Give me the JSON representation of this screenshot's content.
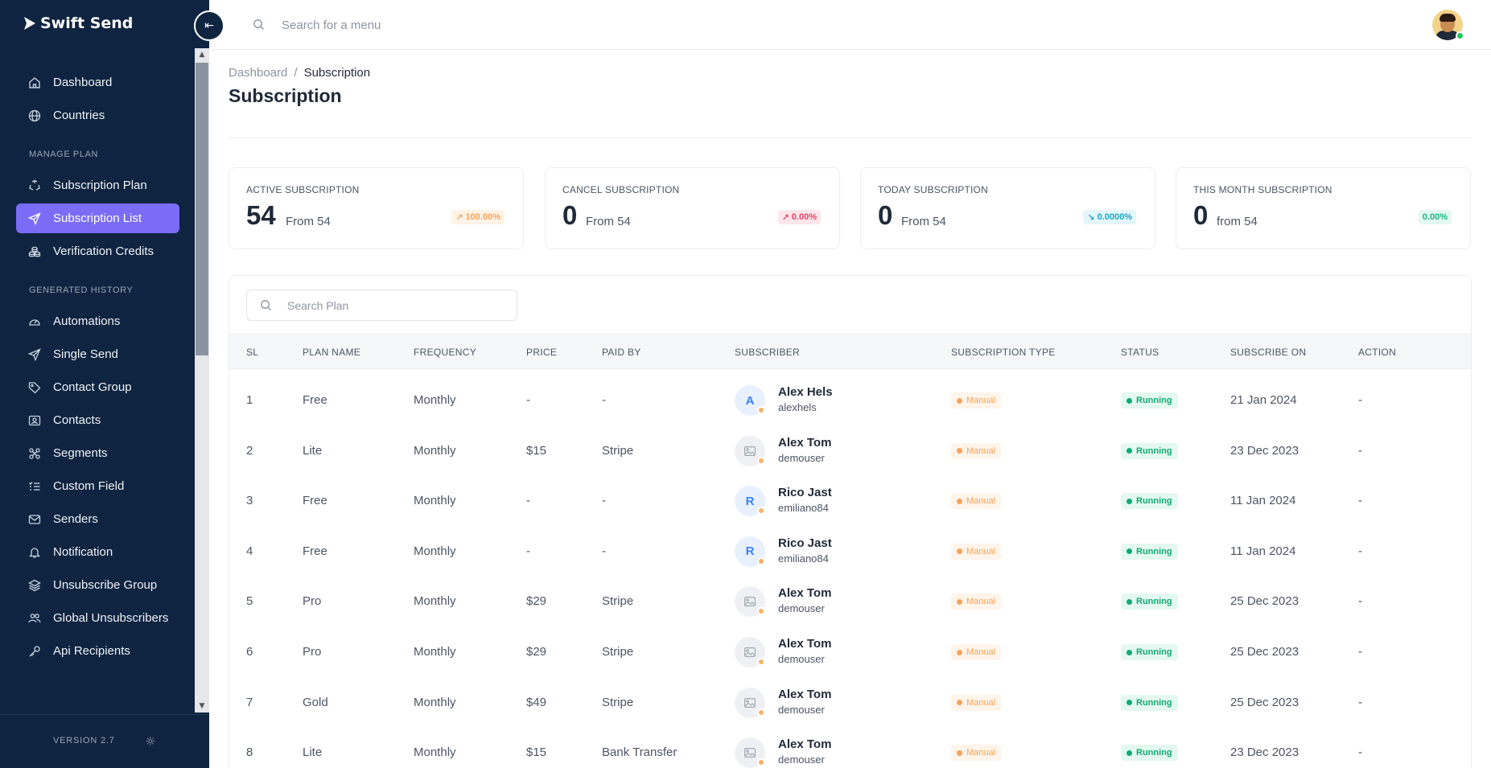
{
  "app": {
    "name": "Swift Send",
    "version": "VERSION 2.7"
  },
  "topbar": {
    "search_placeholder": "Search for a menu"
  },
  "sidebar": {
    "items_top": [
      {
        "label": "Dashboard",
        "icon": "home-icon"
      },
      {
        "label": "Countries",
        "icon": "globe-icon"
      }
    ],
    "section_manage": "MANAGE PLAN",
    "items_manage": [
      {
        "label": "Subscription Plan",
        "icon": "recycle-icon"
      },
      {
        "label": "Subscription List",
        "icon": "paper-plane-icon",
        "active": true
      },
      {
        "label": "Verification Credits",
        "icon": "coins-icon"
      }
    ],
    "section_history": "GENERATED HISTORY",
    "items_history": [
      {
        "label": "Automations",
        "icon": "gauge-icon"
      },
      {
        "label": "Single Send",
        "icon": "paper-plane-icon"
      },
      {
        "label": "Contact Group",
        "icon": "tag-icon"
      },
      {
        "label": "Contacts",
        "icon": "contact-card-icon"
      },
      {
        "label": "Segments",
        "icon": "segments-icon"
      },
      {
        "label": "Custom Field",
        "icon": "list-check-icon"
      },
      {
        "label": "Senders",
        "icon": "mail-icon"
      },
      {
        "label": "Notification",
        "icon": "bell-icon"
      },
      {
        "label": "Unsubscribe Group",
        "icon": "layers-icon"
      },
      {
        "label": "Global Unsubscribers",
        "icon": "users-icon"
      },
      {
        "label": "Api Recipients",
        "icon": "key-icon"
      }
    ]
  },
  "page": {
    "breadcrumb_root": "Dashboard",
    "breadcrumb_sep": "/",
    "breadcrumb_current": "Subscription",
    "title": "Subscription"
  },
  "stats": [
    {
      "label": "ACTIVE SUBSCRIPTION",
      "value": "54",
      "from": "From 54",
      "badge": "100.00%",
      "color": "#f6a35c"
    },
    {
      "label": "CANCEL SUBSCRIPTION",
      "value": "0",
      "from": "From 54",
      "badge": "0.00%",
      "color": "#e94367"
    },
    {
      "label": "TODAY SUBSCRIPTION",
      "value": "0",
      "from": "From 54",
      "badge": "0.0000%",
      "color": "#1aa8c1"
    },
    {
      "label": "THIS MONTH SUBSCRIPTION",
      "value": "0",
      "from": "from 54",
      "badge": "0.00%",
      "color": "#18b883"
    }
  ],
  "table": {
    "search_placeholder": "Search Plan",
    "headers": [
      "SL",
      "PLAN NAME",
      "FREQUENCY",
      "PRICE",
      "PAID BY",
      "SUBSCRIBER",
      "SUBSCRIPTION TYPE",
      "STATUS",
      "SUBSCRIBE ON",
      "ACTION"
    ],
    "rows": [
      {
        "sl": "1",
        "plan": "Free",
        "frequency": "Monthly",
        "price": "-",
        "paid_by": "-",
        "avatar": "A",
        "name": "Alex Hels",
        "username": "alexhels",
        "type": "Manual",
        "status": "Running",
        "date": "21 Jan 2024",
        "action": "-"
      },
      {
        "sl": "2",
        "plan": "Lite",
        "frequency": "Monthly",
        "price": "$15",
        "paid_by": "Stripe",
        "avatar": "",
        "name": "Alex Tom",
        "username": "demouser",
        "type": "Manual",
        "status": "Running",
        "date": "23 Dec 2023",
        "action": "-"
      },
      {
        "sl": "3",
        "plan": "Free",
        "frequency": "Monthly",
        "price": "-",
        "paid_by": "-",
        "avatar": "R",
        "name": "Rico Jast",
        "username": "emiliano84",
        "type": "Manual",
        "status": "Running",
        "date": "11 Jan 2024",
        "action": "-"
      },
      {
        "sl": "4",
        "plan": "Free",
        "frequency": "Monthly",
        "price": "-",
        "paid_by": "-",
        "avatar": "R",
        "name": "Rico Jast",
        "username": "emiliano84",
        "type": "Manual",
        "status": "Running",
        "date": "11 Jan 2024",
        "action": "-"
      },
      {
        "sl": "5",
        "plan": "Pro",
        "frequency": "Monthly",
        "price": "$29",
        "paid_by": "Stripe",
        "avatar": "",
        "name": "Alex Tom",
        "username": "demouser",
        "type": "Manual",
        "status": "Running",
        "date": "25 Dec 2023",
        "action": "-"
      },
      {
        "sl": "6",
        "plan": "Pro",
        "frequency": "Monthly",
        "price": "$29",
        "paid_by": "Stripe",
        "avatar": "",
        "name": "Alex Tom",
        "username": "demouser",
        "type": "Manual",
        "status": "Running",
        "date": "25 Dec 2023",
        "action": "-"
      },
      {
        "sl": "7",
        "plan": "Gold",
        "frequency": "Monthly",
        "price": "$49",
        "paid_by": "Stripe",
        "avatar": "",
        "name": "Alex Tom",
        "username": "demouser",
        "type": "Manual",
        "status": "Running",
        "date": "25 Dec 2023",
        "action": "-"
      },
      {
        "sl": "8",
        "plan": "Lite",
        "frequency": "Monthly",
        "price": "$15",
        "paid_by": "Bank Transfer",
        "avatar": "",
        "name": "Alex Tom",
        "username": "demouser",
        "type": "Manual",
        "status": "Running",
        "date": "23 Dec 2023",
        "action": "-"
      }
    ]
  },
  "colors": {
    "sidebar_bg": "#0f2440",
    "accent": "#7b6cf6",
    "running": "#13a874",
    "manual": "#f6a35c"
  }
}
